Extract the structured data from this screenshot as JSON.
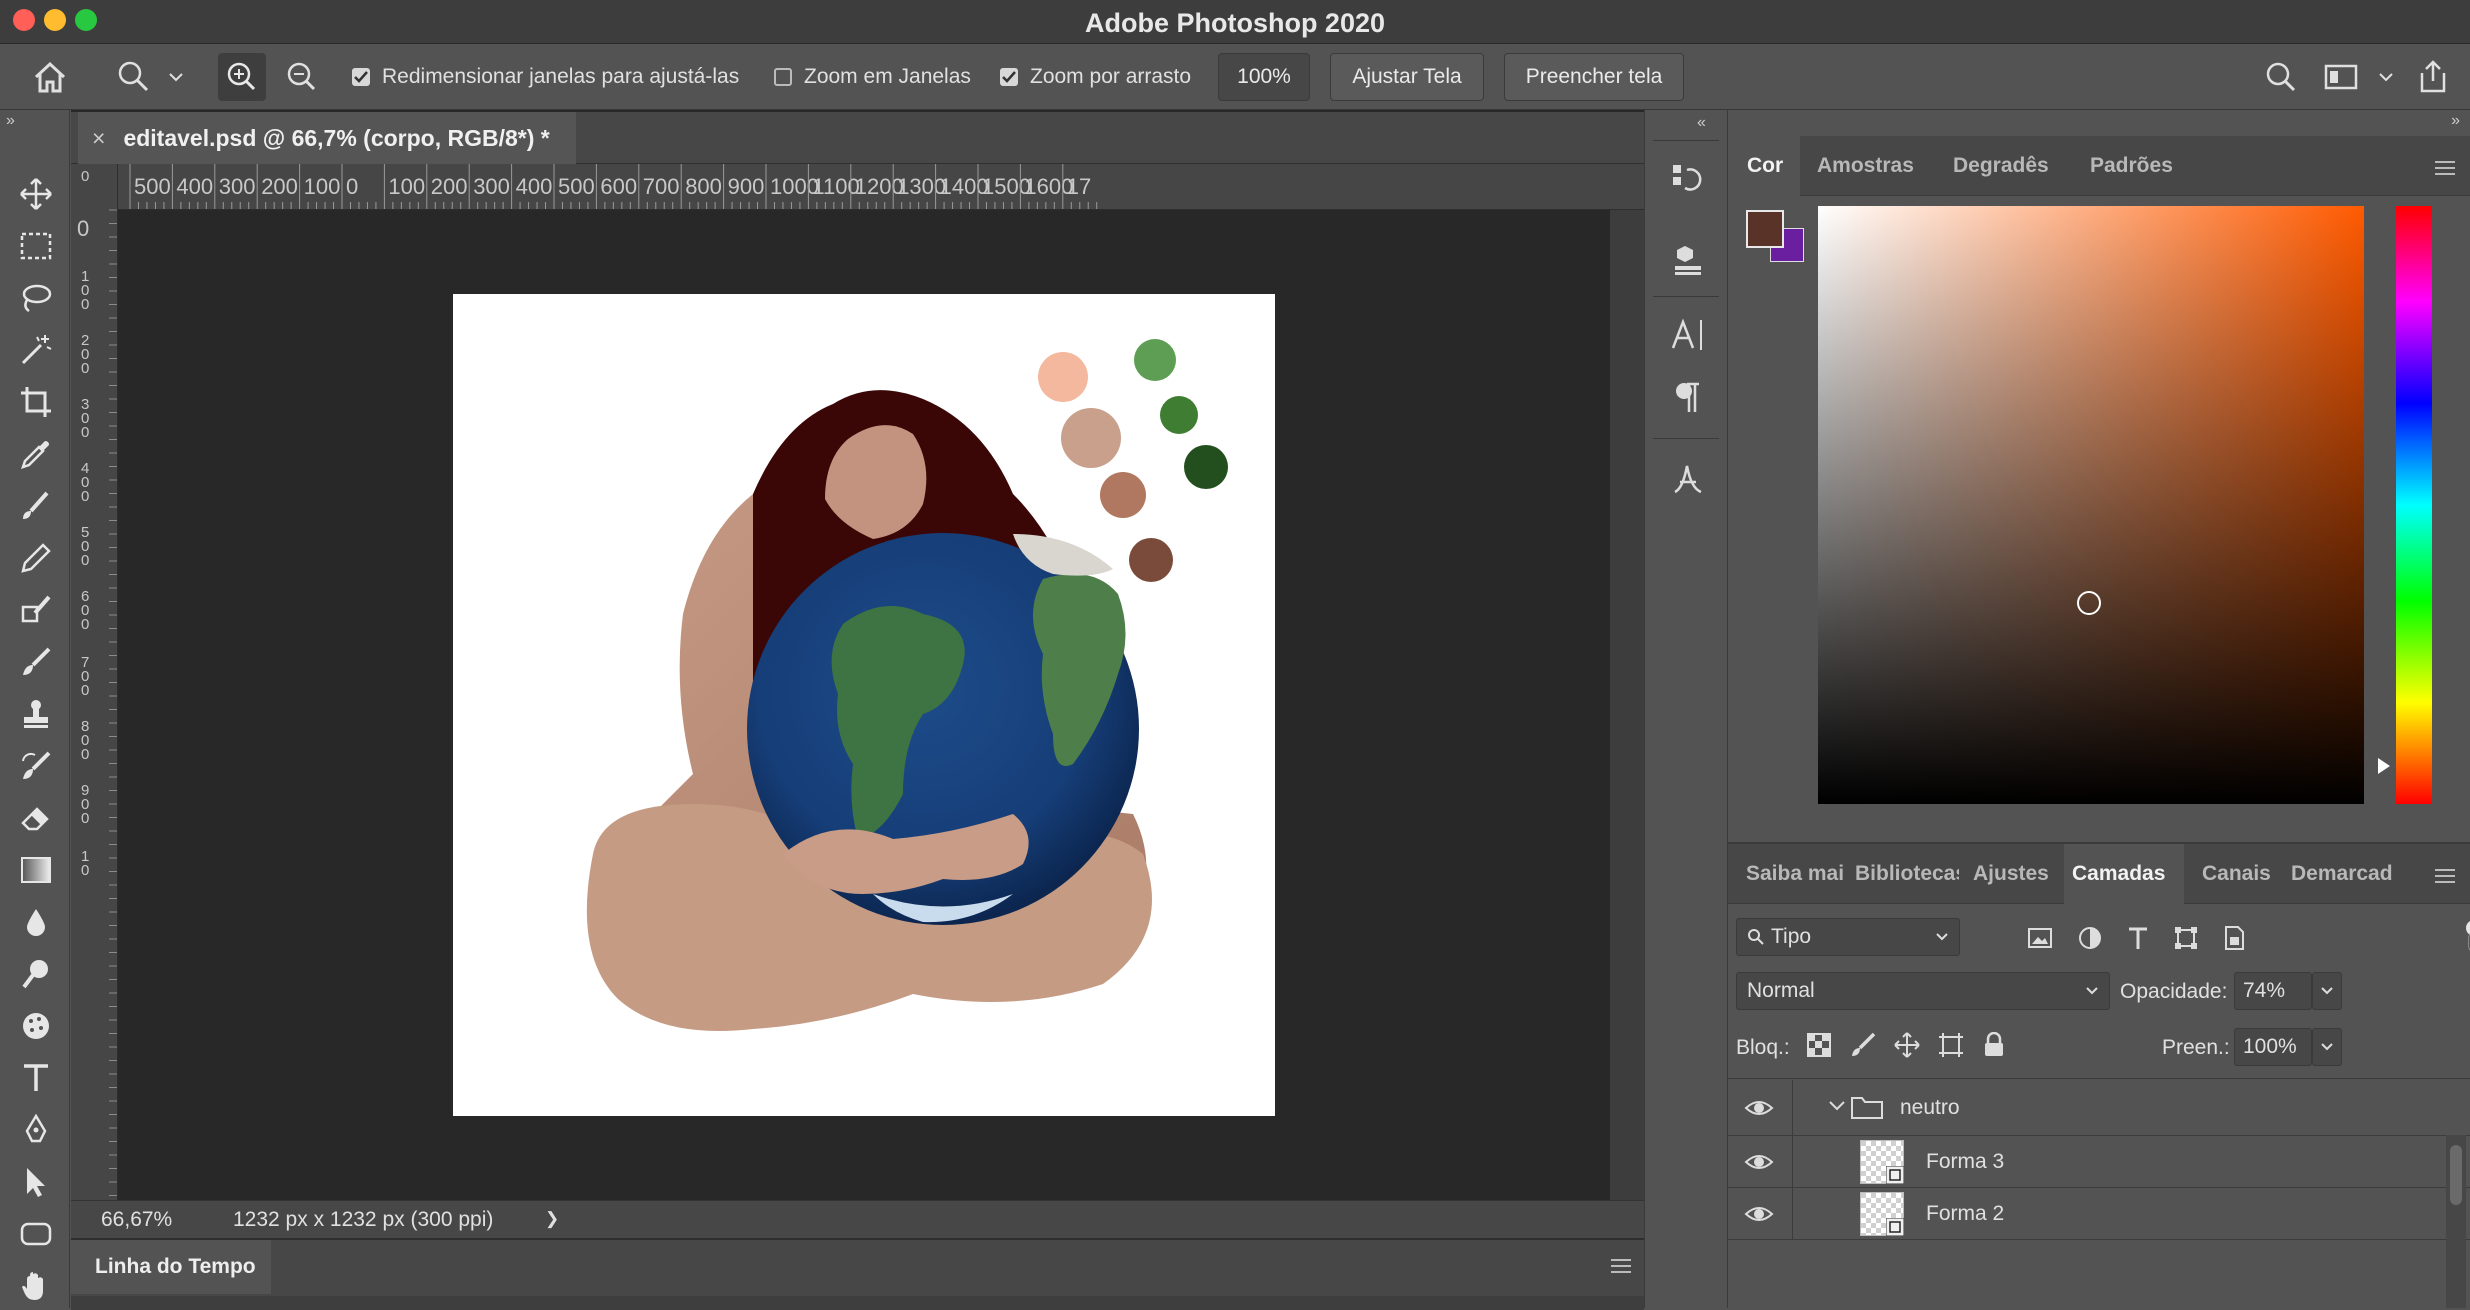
{
  "app": {
    "title": "Adobe Photoshop 2020"
  },
  "options_bar": {
    "resize_windows_label": "Redimensionar janelas para ajustá-las",
    "zoom_all_windows_label": "Zoom em Janelas",
    "scrubby_zoom_label": "Zoom por arrasto",
    "zoom_value": "100%",
    "fit_screen_label": "Ajustar Tela",
    "fill_screen_label": "Preencher tela",
    "resize_windows_checked": true,
    "zoom_all_windows_checked": false,
    "scrubby_zoom_checked": true
  },
  "document": {
    "tab_title": "editavel.psd @ 66,7% (corpo, RGB/8*) *",
    "close_symbol": "×",
    "ruler_h": [
      "500",
      "400",
      "300",
      "200",
      "100",
      "0",
      "100",
      "200",
      "300",
      "400",
      "500",
      "600",
      "700",
      "800",
      "900",
      "1000",
      "1100",
      "1200",
      "1300",
      "1400",
      "1500",
      "1600",
      "17"
    ],
    "ruler_v": [
      [
        "0"
      ],
      [
        "0"
      ],
      [
        "1",
        "0",
        "0"
      ],
      [
        "2",
        "0",
        "0"
      ],
      [
        "3",
        "0",
        "0"
      ],
      [
        "4",
        "0",
        "0"
      ],
      [
        "5",
        "0",
        "0"
      ],
      [
        "6",
        "0",
        "0"
      ],
      [
        "7",
        "0",
        "0"
      ],
      [
        "8",
        "0",
        "0"
      ],
      [
        "9",
        "0",
        "0"
      ],
      [
        "1",
        "0"
      ]
    ]
  },
  "status": {
    "zoom": "66,67%",
    "info": "1232 px x 1232 px (300 ppi)",
    "arrow": "❯"
  },
  "timeline": {
    "label": "Linha do Tempo"
  },
  "color_panel": {
    "tabs": [
      "Cor",
      "Amostras",
      "Degradês",
      "Padrões"
    ],
    "foreground": "#5a3328",
    "background": "#6a1fa0",
    "hue_base": "#ff5a00"
  },
  "layers_panel": {
    "tabs": [
      "Saiba mai",
      "Bibliotecas",
      "Ajustes",
      "Camadas",
      "Canais",
      "Demarcad"
    ],
    "filter_label": "Tipo",
    "blend_mode": "Normal",
    "opacity_label": "Opacidade:",
    "opacity_value": "74%",
    "lock_label": "Bloq.:",
    "fill_label": "Preen.:",
    "fill_value": "100%",
    "group_name": "neutro",
    "layers": [
      {
        "name": "Forma 3"
      },
      {
        "name": "Forma 2"
      }
    ]
  },
  "swatches_on_canvas": [
    "#f4b89e",
    "#5e9e54",
    "#c9a08c",
    "#3f7d33",
    "#b07860",
    "#234f1e",
    "#7a4a3a"
  ]
}
